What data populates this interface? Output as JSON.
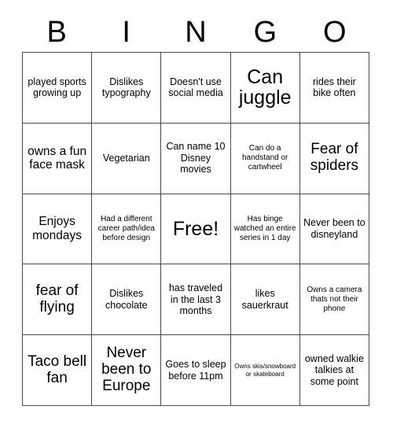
{
  "card": {
    "type": "bingo-card",
    "header_letters": [
      "B",
      "I",
      "N",
      "G",
      "O"
    ],
    "grid_size": 5,
    "colors": {
      "background": "#ffffff",
      "text": "#000000",
      "grid_line": "#4a4a4a"
    },
    "rows": [
      [
        {
          "text": "played sports growing up",
          "size": "md"
        },
        {
          "text": "Dislikes typography",
          "size": "md"
        },
        {
          "text": "Doesn't use social media",
          "size": "md"
        },
        {
          "text": "Can juggle",
          "size": "xxl"
        },
        {
          "text": "rides their bike often",
          "size": "md"
        }
      ],
      [
        {
          "text": "owns a fun face mask",
          "size": "lg"
        },
        {
          "text": "Vegetarian",
          "size": "md"
        },
        {
          "text": "Can name 10 Disney movies",
          "size": "md"
        },
        {
          "text": "Can do a handstand or cartwheel",
          "size": "sm"
        },
        {
          "text": "Fear of spiders",
          "size": "xl"
        }
      ],
      [
        {
          "text": "Enjoys mondays",
          "size": "lg"
        },
        {
          "text": "Had a different career path/idea before design",
          "size": "sm"
        },
        {
          "text": "Free!",
          "size": "xxl"
        },
        {
          "text": "Has binge watched an entire series in 1 day",
          "size": "sm"
        },
        {
          "text": "Never been to disneyland",
          "size": "md"
        }
      ],
      [
        {
          "text": "fear of flying",
          "size": "xl"
        },
        {
          "text": "Dislikes chocolate",
          "size": "md"
        },
        {
          "text": "has traveled in the last 3 months",
          "size": "md"
        },
        {
          "text": "likes sauerkraut",
          "size": "md"
        },
        {
          "text": "Owns a camera thats not their phone",
          "size": "sm"
        }
      ],
      [
        {
          "text": "Taco bell fan",
          "size": "xl"
        },
        {
          "text": "Never been to Europe",
          "size": "xl"
        },
        {
          "text": "Goes to sleep before 11pm",
          "size": "md"
        },
        {
          "text": "Owns skis/snowboard or skateboard",
          "size": "xs"
        },
        {
          "text": "owned walkie talkies at some point",
          "size": "md"
        }
      ]
    ]
  }
}
